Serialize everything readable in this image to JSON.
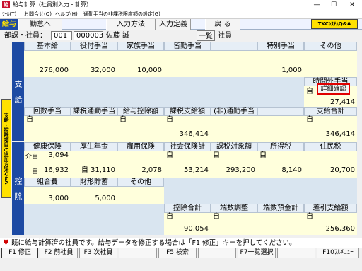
{
  "window": {
    "icon_text": "給",
    "title": "給与計算（社員別入力・計算）",
    "min": "—",
    "max": "☐",
    "close": "✕"
  },
  "menu": [
    "ﾂｰﾙ(T)",
    "お問合せ(Q)",
    "ヘルプ(H)",
    "通勤手当の非課税限度額の設定(G)"
  ],
  "toolbar": {
    "tag": "給与",
    "items": [
      "勤怠へ",
      "入力方法",
      "入力定義",
      "戻 る"
    ],
    "tkc": "TKCｼｽﾃﾑQ&A"
  },
  "dept": {
    "label": "部課・社員：",
    "dept_code": "001",
    "emp_code": "000003",
    "name": "佐藤 誠",
    "list_btn": "一覧",
    "emp_type": "社員"
  },
  "side": {
    "pay": "支　給",
    "deduct": "控　除",
    "strip": "支給・控除項目の追加方法Q&A"
  },
  "pay": {
    "headers1": [
      "基本給",
      "役付手当",
      "家族手当",
      "皆勤手当",
      "",
      "特別手当",
      "その他"
    ],
    "values1": [
      "276,000",
      "32,000",
      "10,000",
      "",
      "",
      "1,000",
      ""
    ],
    "overtime_label": "時間外手当",
    "ji": "自",
    "detail_btn": "詳細確認",
    "overtime_value": "27,414",
    "headers2": [
      "回数手当",
      "課税通勤手当",
      "給与控除額",
      "課税支給額",
      "(非)通勤手当",
      "",
      "支給合計"
    ],
    "marks2": [
      "自",
      "",
      "自",
      "自",
      "",
      "",
      "自"
    ],
    "taxable_pay": "346,414",
    "total_pay": "346,414"
  },
  "deduct": {
    "headers1": [
      "健康保険",
      "厚生年金",
      "雇用保険",
      "社会保険計",
      "課税対象額",
      "所得税",
      "住民税"
    ],
    "health_care_kaigo": "介自",
    "health_care_kaigo_value": "3,094",
    "health_ippan": "一自",
    "health_ippan_value": "16,932",
    "pension": "自 31,110",
    "employment": "2,078",
    "social_total_mark": "自",
    "social_total": "53,214",
    "taxable_mark": "自",
    "taxable": "293,200",
    "income_tax_mark": "自",
    "income_tax": "8,140",
    "resident_tax": "20,700",
    "headers2": [
      "組合費",
      "財形貯蓄",
      "その他"
    ],
    "union": "3,000",
    "savings": "5,000",
    "headers3": [
      "控除合計",
      "端数調整",
      "端数預金計",
      "差引支給額"
    ],
    "marks3": [
      "自",
      "自",
      "",
      "自"
    ],
    "deduct_total": "90,054",
    "net_pay": "256,360"
  },
  "message": "既に給与計算済の社員です。給与データを修正する場合は「F1 修正」キーを押してください。",
  "fkeys": [
    "F1 修正",
    "F2 前社員",
    "F3 次社員",
    "",
    "F5 検索",
    "",
    "F7一覧選択",
    "",
    "F10ﾌﾙﾒﾆｭｰ"
  ]
}
